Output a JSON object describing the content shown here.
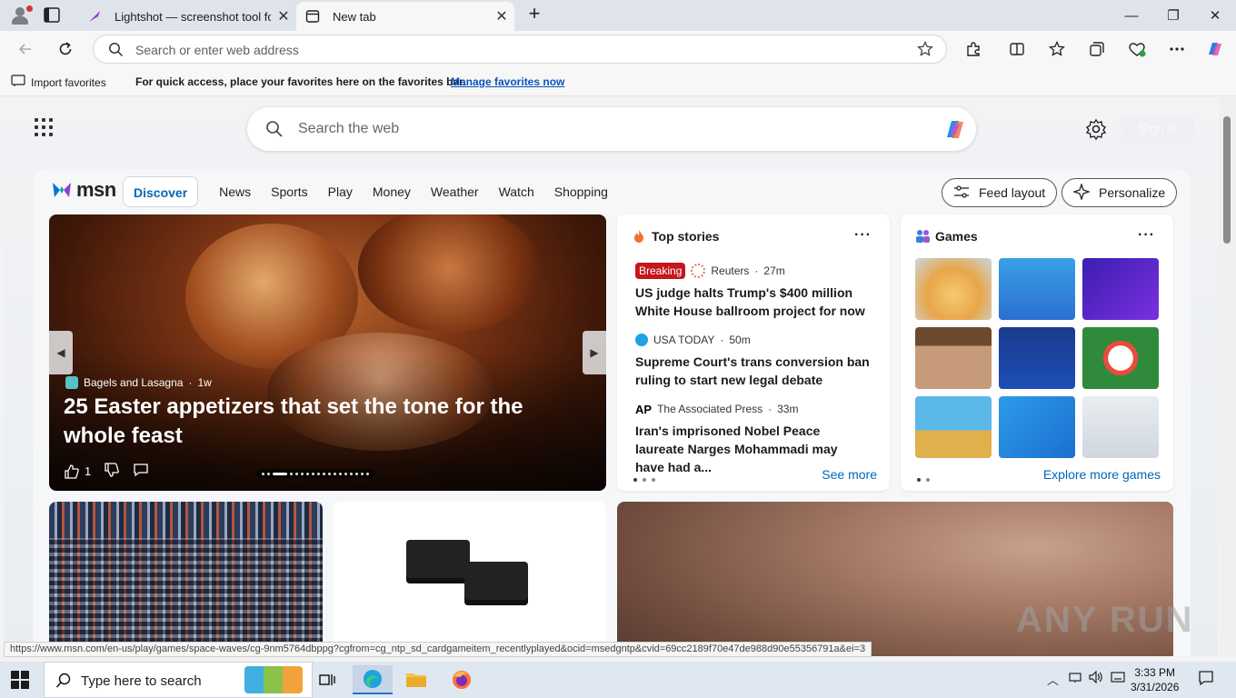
{
  "browser": {
    "tabs": [
      {
        "label": "Lightshot — screenshot tool for Mac & Win",
        "active": false
      },
      {
        "label": "New tab",
        "active": true
      }
    ],
    "address_placeholder": "Search or enter web address",
    "favorites_bar": {
      "import_label": "Import favorites",
      "message": "For quick access, place your favorites here on the favorites bar.",
      "manage_link": "Manage favorites now"
    }
  },
  "newtab": {
    "search_placeholder": "Search the web",
    "sign_in": "Sign in"
  },
  "msn": {
    "logo_text": "msn",
    "nav": [
      "Discover",
      "News",
      "Sports",
      "Play",
      "Money",
      "Weather",
      "Watch",
      "Shopping"
    ],
    "feed_layout": "Feed layout",
    "personalize": "Personalize",
    "hero": {
      "source": "Bagels and Lasagna",
      "age": "1w",
      "headline": "25 Easter appetizers that set the tone for the whole feast",
      "likes": "1"
    },
    "top_stories": {
      "title": "Top stories",
      "items": [
        {
          "badge": "Breaking",
          "source": "Reuters",
          "age": "27m",
          "headline": "US judge halts Trump's $400 million White House ballroom project for now"
        },
        {
          "source": "USA TODAY",
          "age": "50m",
          "headline": "Supreme Court's trans conversion ban ruling to start new legal debate"
        },
        {
          "source": "The Associated Press",
          "age": "33m",
          "headline": "Iran's imprisoned Nobel Peace laureate Narges Mohammadi may have had a..."
        }
      ],
      "see_more": "See more"
    },
    "games": {
      "title": "Games",
      "explore": "Explore more games"
    }
  },
  "status_url": "https://www.msn.com/en-us/play/games/space-waves/cg-9nm5764dbppg?cgfrom=cg_ntp_sd_cardgameitem_recentlyplayed&ocid=msedgntp&cvid=69cc2189f70e47de988d90e55356791a&ei=3",
  "watermark": "ANY RUN",
  "taskbar": {
    "search_placeholder": "Type here to search",
    "time": "3:33 PM",
    "date": "3/31/2026"
  }
}
